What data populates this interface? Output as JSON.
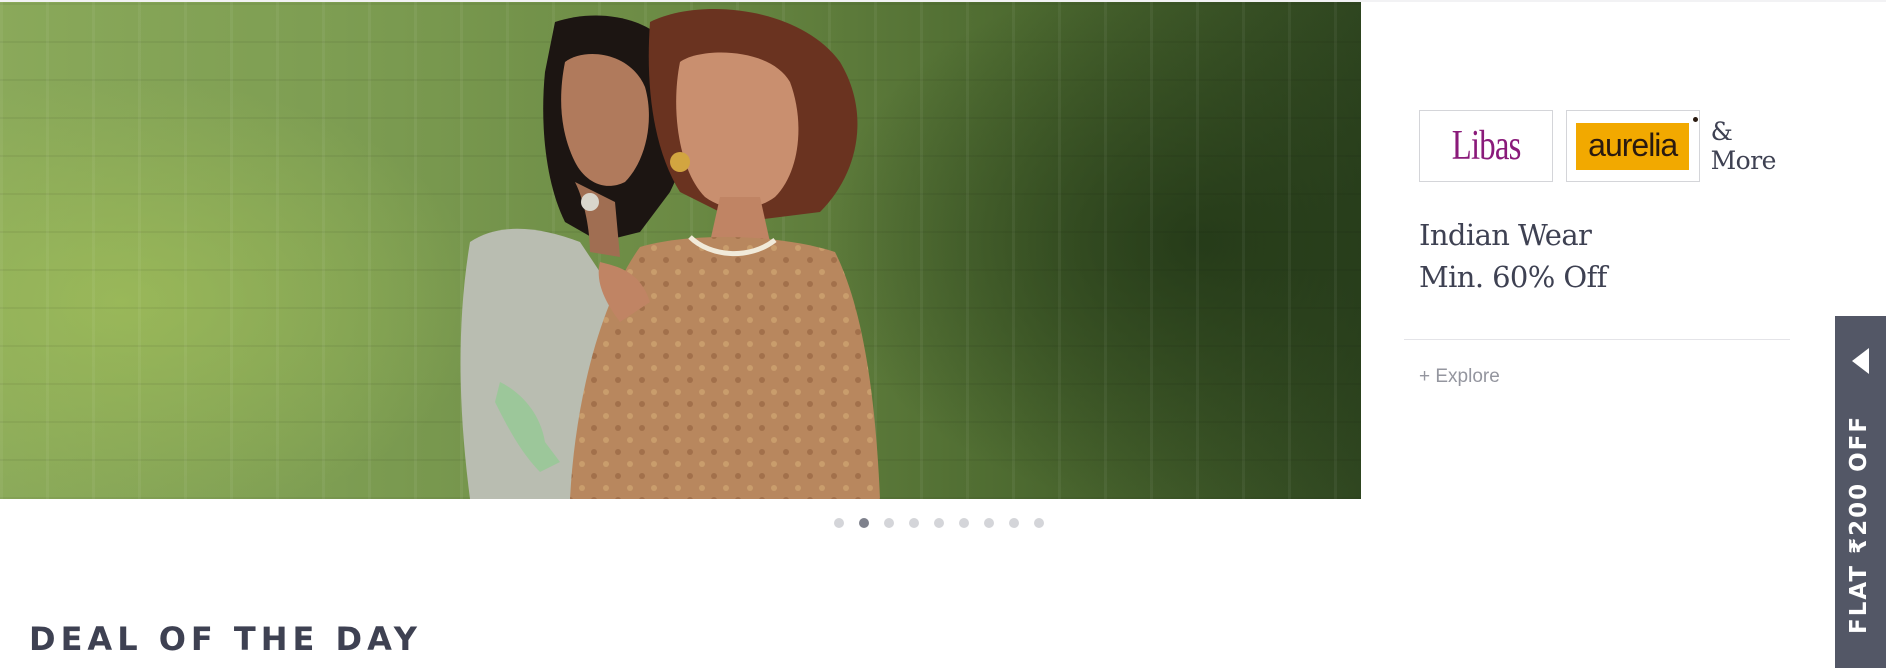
{
  "banner": {
    "image_description_icon": "banner-image",
    "dots_count": 9,
    "active_dot": 1
  },
  "promo": {
    "brands": [
      "Libas",
      "aurelia"
    ],
    "more_label": "& More",
    "title_line1": "Indian Wear",
    "title_line2": "Min. 60% Off",
    "explore_label": "+ Explore"
  },
  "deal_section": {
    "heading": "DEAL OF THE DAY"
  },
  "side_tab": {
    "label": "FLAT ₹200 OFF"
  },
  "colors": {
    "text_primary": "#3e4152",
    "libas_purple": "#8a1a7a",
    "aurelia_yellow": "#f2a900",
    "side_tab_bg": "#535766",
    "dot_inactive": "#d4d5d9",
    "dot_active": "#7e818c"
  }
}
